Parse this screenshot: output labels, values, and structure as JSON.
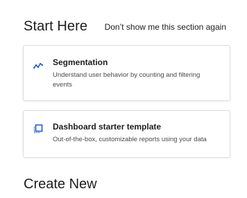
{
  "start_section": {
    "title": "Start Here",
    "dismiss_label": "Don’t show me this section again",
    "cards": [
      {
        "icon": "segmentation-chart-icon",
        "title": "Segmentation",
        "description": "Understand user behavior by counting and filtering events"
      },
      {
        "icon": "dashboard-template-icon",
        "title": "Dashboard starter template",
        "description": "Out-of-the-box, customizable reports using your data"
      }
    ]
  },
  "create_section": {
    "title": "Create New"
  },
  "colors": {
    "accent": "#1f5ad6",
    "card_border": "#dcdcdc",
    "text_primary": "#1d1d1d",
    "text_secondary": "#4a4a4a"
  }
}
